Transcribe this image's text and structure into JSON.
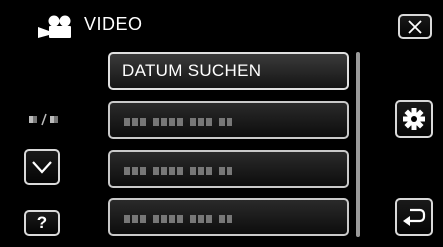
{
  "header": {
    "title": "VIDEO",
    "mode_icon": "camcorder-icon"
  },
  "buttons": {
    "close_icon": "close-icon",
    "settings_icon": "gear-icon",
    "back_icon": "return-icon",
    "down_icon": "chevron-down-icon",
    "help_label": "?"
  },
  "menu": {
    "items": [
      {
        "label": "DATUM SUCHEN",
        "selected": true
      },
      {
        "label": "",
        "placeholder": true
      },
      {
        "label": "",
        "placeholder": true
      },
      {
        "label": "",
        "placeholder": true
      }
    ]
  },
  "colors": {
    "background": "#000000",
    "border": "#d9d9d9",
    "placeholder": "#777777"
  }
}
